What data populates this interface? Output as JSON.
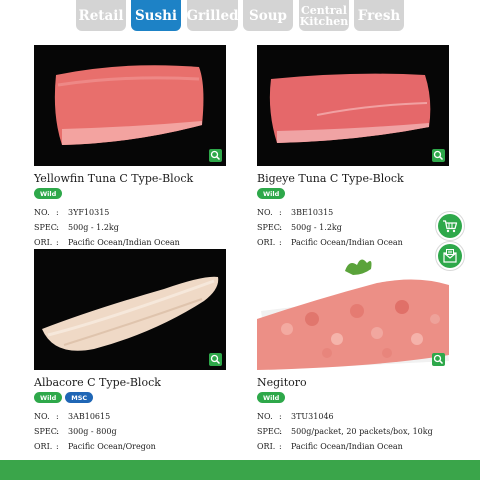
{
  "tabs": [
    {
      "label": "Retail",
      "active": false
    },
    {
      "label": "Sushi",
      "active": true
    },
    {
      "label": "Grilled",
      "active": false
    },
    {
      "label": "Soup",
      "active": false
    },
    {
      "label": "Central Kitchen",
      "line1": "Central",
      "line2": "Kitchen",
      "active": false
    },
    {
      "label": "Fresh",
      "active": false
    }
  ],
  "colors": {
    "accent": "#1d82c6",
    "tab_inactive": "#d4d4d4",
    "badge_wild": "#2ea84a",
    "badge_msc": "#1f66b5",
    "footer": "#3aa54a"
  },
  "spec_labels": {
    "no": "NO.",
    "spec": "SPEC.",
    "ori": "ORI.",
    "colon": ":"
  },
  "products": [
    {
      "name": "Yellowfin Tuna C Type-Block",
      "badges": [
        "Wild"
      ],
      "no": "3YF10315",
      "spec": "500g - 1.2kg",
      "ori": "Pacific Ocean/Indian Ocean",
      "icon": "zoom-icon"
    },
    {
      "name": "Bigeye Tuna C Type-Block",
      "badges": [
        "Wild"
      ],
      "no": "3BE10315",
      "spec": "500g - 1.2kg",
      "ori": "Pacific Ocean/Indian Ocean",
      "icon": "zoom-icon"
    },
    {
      "name": "Albacore C Type-Block",
      "badges": [
        "Wild",
        "MSC"
      ],
      "no": "3AB10615",
      "spec": "300g - 800g",
      "ori": "Pacific Ocean/Oregon",
      "icon": "zoom-icon"
    },
    {
      "name": "Negitoro",
      "badges": [
        "Wild"
      ],
      "no": "3TU31046",
      "spec": "500g/packet, 20 packets/box, 10kg",
      "ori": "Pacific Ocean/Indian Ocean",
      "icon": "zoom-icon"
    }
  ],
  "floating": [
    {
      "icon": "cart-icon"
    },
    {
      "icon": "mail-icon"
    }
  ]
}
